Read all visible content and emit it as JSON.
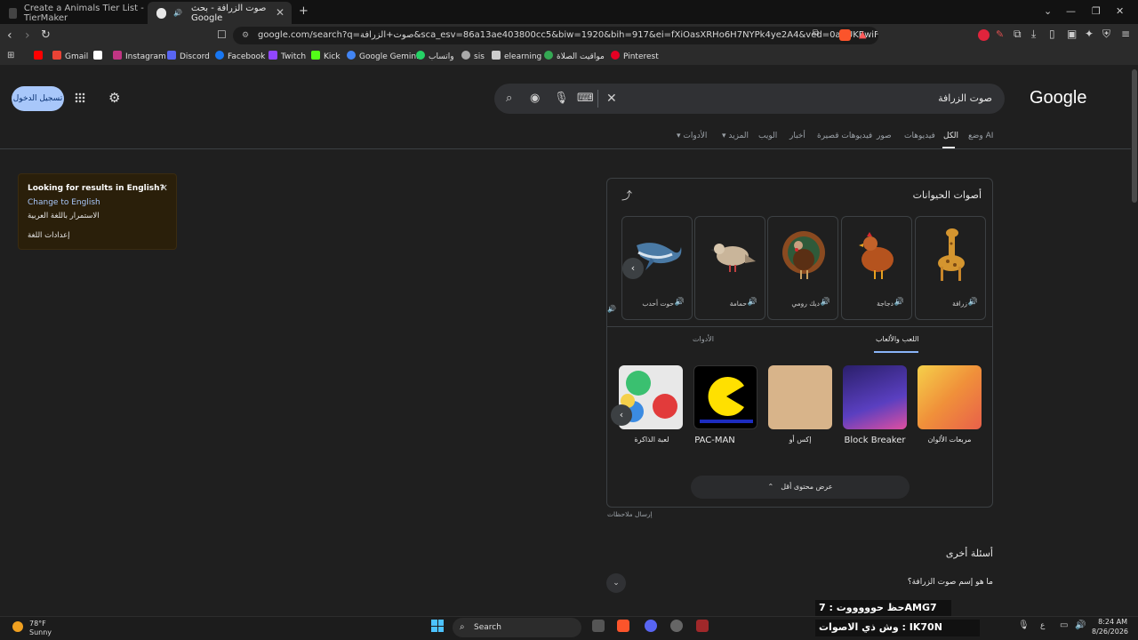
{
  "tabs": [
    {
      "title": "Create a Animals Tier List - TierMaker",
      "favicon": "tiermaker-icon"
    },
    {
      "title": "صوت الزرافة - بحث Google",
      "favicon": "google-icon",
      "audio": "speaker-icon"
    }
  ],
  "address_bar": {
    "url": "google.com/search?q=صوت+الزرافة&sca_esv=86a13ae403800cc5&biw=1920&bih=917&ei=fXiOasXRHo6H7NYPk4ye2A4&ved=0ahUKEwiFhKTwxr..."
  },
  "bookmarks": [
    {
      "label": "Gmail",
      "color": "#ea4335"
    },
    {
      "label": "Instagram",
      "color": "#c13584"
    },
    {
      "label": "Discord",
      "color": "#5865f2"
    },
    {
      "label": "Facebook",
      "color": "#1877f2"
    },
    {
      "label": "Twitch",
      "color": "#9146ff"
    },
    {
      "label": "Kick",
      "color": "#53fc18"
    },
    {
      "label": "Google Gemini",
      "color": "#4285f4"
    },
    {
      "label": "واتساب",
      "color": "#25d366"
    },
    {
      "label": "sis",
      "color": "#aaaaaa"
    },
    {
      "label": "elearning",
      "color": "#cccccc"
    },
    {
      "label": "مواقيت الصلاة",
      "color": "#34a853"
    },
    {
      "label": "Pinterest",
      "color": "#e60023"
    }
  ],
  "google": {
    "logo": "Google",
    "query": "صوت الزرافة",
    "signin": "تسجيل الدخول",
    "nav": [
      {
        "label": "وضع AI"
      },
      {
        "label": "الكل"
      },
      {
        "label": "فيديوهات"
      },
      {
        "label": "صور"
      },
      {
        "label": "فيديوهات قصيرة"
      },
      {
        "label": "أخبار"
      },
      {
        "label": "الويب"
      },
      {
        "label": "المزيد"
      },
      {
        "label": "الأدوات"
      }
    ]
  },
  "lang_popup": {
    "title": "Looking for results in English?",
    "change": "Change to English",
    "keep": "الاستمرار باللغة العربية",
    "settings": "إعدادات اللغة"
  },
  "card": {
    "title": "أصوات الحيوانات",
    "animals": [
      {
        "label": "زرافة",
        "color": "#c8862a"
      },
      {
        "label": "دجاجة",
        "color": "#b5531e"
      },
      {
        "label": "ديك رومي",
        "color": "#6b3a1c"
      },
      {
        "label": "حمامة",
        "color": "#c9b59a"
      },
      {
        "label": "حوت أحدب",
        "color": "#4a7aa5"
      }
    ],
    "subtabs": {
      "active": "اللعب والألعاب",
      "other": "الأدوات"
    },
    "games": [
      {
        "label": "مربعات الألوان",
        "color": "#f0b030"
      },
      {
        "label": "Block Breaker",
        "color": "#3a2f8a"
      },
      {
        "label": "إكس أو",
        "color": "#c9a27a"
      },
      {
        "label": "PAC-MAN",
        "color": "#000000"
      },
      {
        "label": "لعبة الذاكرة",
        "color": "#3ac070"
      }
    ],
    "show_less": "عرض محتوى أقل",
    "feedback": "إرسال ملاحظات"
  },
  "paa": {
    "title": "أسئلة أخرى",
    "question": "ما هو إسم صوت الزرافة؟"
  },
  "overlay": {
    "line1": "حظ حوووووت : 7AMG7",
    "line2": "وش ذي الاصوات : IK70N"
  },
  "taskbar": {
    "temp": "78°F",
    "condition": "Sunny",
    "search": "Search",
    "time": "8:24 AM",
    "date": "8/26/2026"
  }
}
